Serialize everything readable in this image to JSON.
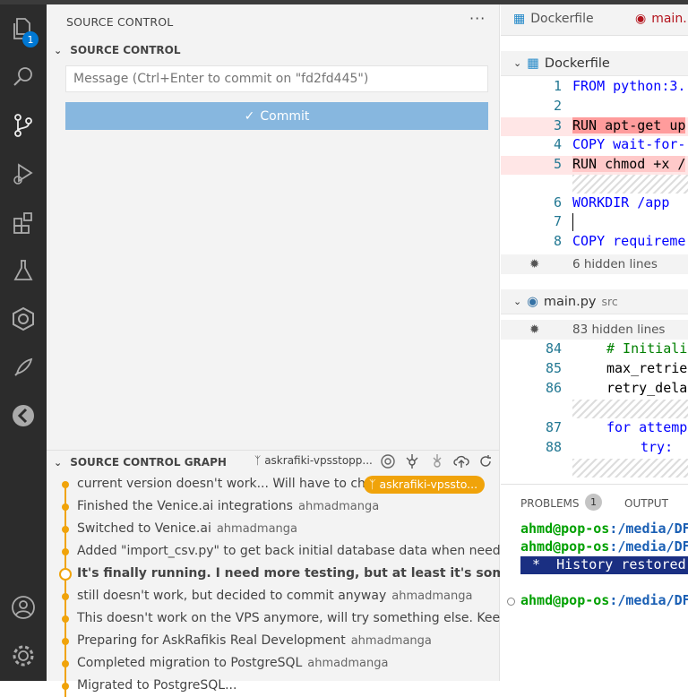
{
  "activity_bar": {
    "explorer_badge": "1"
  },
  "source_control": {
    "title": "SOURCE CONTROL",
    "more": "···",
    "section": "SOURCE CONTROL",
    "message_placeholder": "Message (Ctrl+Enter to commit on \"fd2fd445\")",
    "commit_label": "Commit"
  },
  "graph": {
    "title": "SOURCE CONTROL GRAPH",
    "branch": "askrafiki-vpsstopp...",
    "commits": [
      {
        "message": "current version doesn't work... Will have to ch...",
        "author": "",
        "tag": "askrafiki-vpssto..."
      },
      {
        "message": "Finished the Venice.ai integrations",
        "author": "ahmadmanga"
      },
      {
        "message": "Switched to Venice.ai",
        "author": "ahmadmanga"
      },
      {
        "message": "Added \"import_csv.py\" to get back initial database data when need...",
        "author": ""
      },
      {
        "message": "It's finally running. I need more testing, but at least it's something...",
        "author": ""
      },
      {
        "message": "still doesn't work, but decided to commit anyway",
        "author": "ahmadmanga"
      },
      {
        "message": "This doesn't work on the VPS anymore, will try something else. Kee...",
        "author": ""
      },
      {
        "message": "Preparing for AskRafikis Real Development",
        "author": "ahmadmanga"
      },
      {
        "message": "Completed migration to PostgreSQL",
        "author": "ahmadmanga"
      },
      {
        "message": "Migrated to PostgreSQL...",
        "author": ""
      }
    ]
  },
  "editor": {
    "tabs": [
      "Dockerfile",
      "main."
    ],
    "dockerfile": {
      "header": "Dockerfile",
      "lines": [
        {
          "n": "1",
          "t": "FROM python:3."
        },
        {
          "n": "2",
          "t": ""
        },
        {
          "n": "3",
          "t": "RUN apt-get up"
        },
        {
          "n": "4",
          "t": "COPY wait-for-"
        },
        {
          "n": "5",
          "t": "RUN chmod +x /"
        },
        {
          "n": "6",
          "t": "WORKDIR /app"
        },
        {
          "n": "7",
          "t": ""
        },
        {
          "n": "8",
          "t": "COPY requireme"
        }
      ],
      "hidden": "6 hidden lines"
    },
    "mainpy": {
      "header": "main.py",
      "sub": "src",
      "hidden": "83 hidden lines",
      "lines": [
        {
          "n": "84",
          "t": "# Initiali"
        },
        {
          "n": "85",
          "t": "max_retrie"
        },
        {
          "n": "86",
          "t": "retry_dela"
        },
        {
          "n": "87",
          "t": "for attemp"
        },
        {
          "n": "88",
          "t": "try:"
        }
      ]
    }
  },
  "panel": {
    "problems": "PROBLEMS",
    "problems_count": "1",
    "output": "OUTPUT",
    "prompt_user": "ahmd@pop-os",
    "prompt_path": ":/media/DF",
    "history": " *  History restored "
  }
}
